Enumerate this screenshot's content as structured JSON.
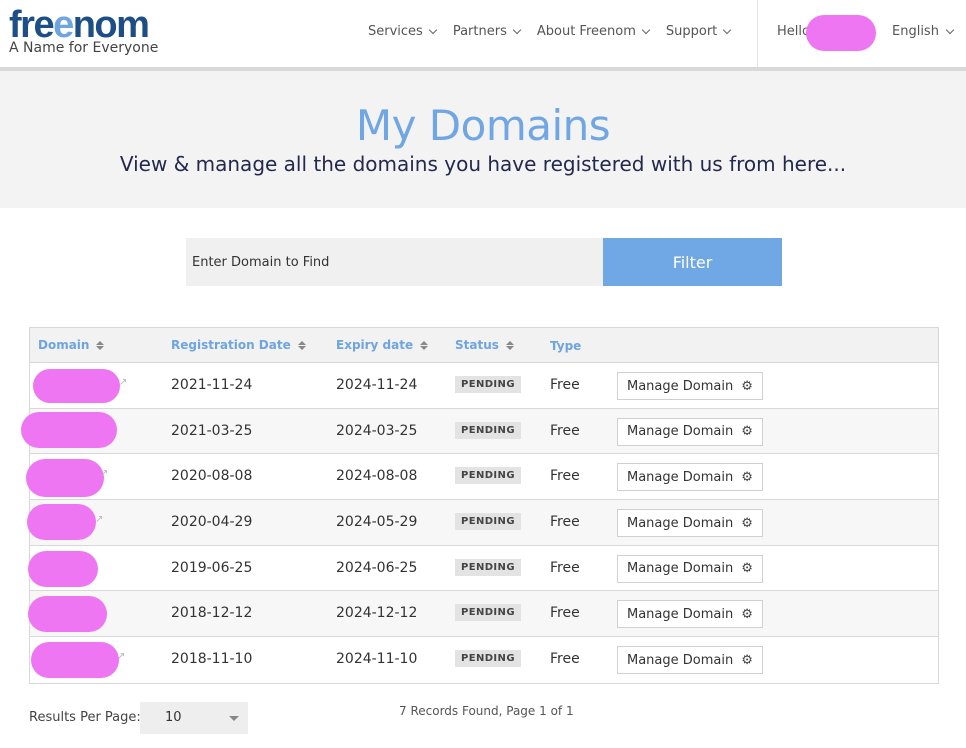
{
  "header": {
    "logo_text": "freenom",
    "tagline": "A Name for Everyone",
    "nav": [
      {
        "label": "Services"
      },
      {
        "label": "Partners"
      },
      {
        "label": "About Freenom"
      },
      {
        "label": "Support"
      }
    ],
    "greeting": "Hello",
    "language": "English"
  },
  "banner": {
    "title": "My Domains",
    "subtitle": "View & manage all the domains you have registered with us from here..."
  },
  "search": {
    "placeholder": "Enter Domain to Find",
    "filter_label": "Filter"
  },
  "table": {
    "columns": [
      "Domain",
      "Registration Date",
      "Expiry date",
      "Status",
      "Type"
    ],
    "manage_label": "Manage Domain",
    "rows": [
      {
        "registration": "2021-11-24",
        "expiry": "2024-11-24",
        "status": "PENDING",
        "type": "Free"
      },
      {
        "registration": "2021-03-25",
        "expiry": "2024-03-25",
        "status": "PENDING",
        "type": "Free"
      },
      {
        "registration": "2020-08-08",
        "expiry": "2024-08-08",
        "status": "PENDING",
        "type": "Free"
      },
      {
        "registration": "2020-04-29",
        "expiry": "2024-05-29",
        "status": "PENDING",
        "type": "Free"
      },
      {
        "registration": "2019-06-25",
        "expiry": "2024-06-25",
        "status": "PENDING",
        "type": "Free"
      },
      {
        "registration": "2018-12-12",
        "expiry": "2024-12-12",
        "status": "PENDING",
        "type": "Free"
      },
      {
        "registration": "2018-11-10",
        "expiry": "2024-11-10",
        "status": "PENDING",
        "type": "Free"
      }
    ]
  },
  "footer": {
    "results_per_page_label": "Results Per Page:",
    "results_per_page_value": "10",
    "records_text": "7 Records Found, Page 1 of 1"
  },
  "colors": {
    "accent": "#6fa6e3",
    "brand_dark": "#1d4f86",
    "redaction": "#ef76f2"
  }
}
